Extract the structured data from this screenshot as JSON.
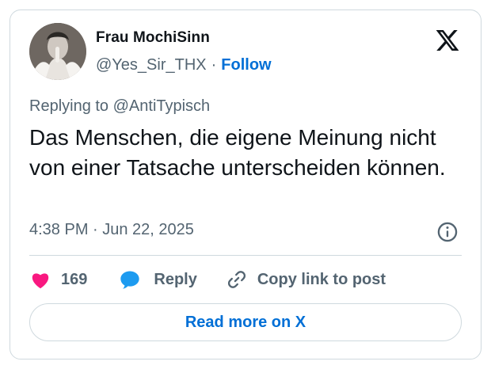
{
  "author": {
    "display_name": "Frau MochiSinn",
    "handle": "@Yes_Sir_THX",
    "separator": "·",
    "follow_label": "Follow"
  },
  "tweet": {
    "replying_to": "Replying to @AntiTypisch",
    "text": "Das Menschen, die eigene Meinung nicht von einer Tatsache unterscheiden können.",
    "timestamp": "4:38 PM · Jun 22, 2025"
  },
  "actions": {
    "like_count": "169",
    "reply_label": "Reply",
    "copy_link_label": "Copy link to post"
  },
  "footer": {
    "read_more_label": "Read more on X"
  },
  "icons": {
    "brand": "x-logo-icon",
    "info": "info-icon",
    "like": "heart-icon",
    "reply": "speech-bubble-icon",
    "copy": "link-icon"
  },
  "colors": {
    "accent": "#006fd6",
    "like": "#f91880",
    "reply": "#1d9bf0",
    "muted": "#536471",
    "border": "#cfd9de"
  }
}
